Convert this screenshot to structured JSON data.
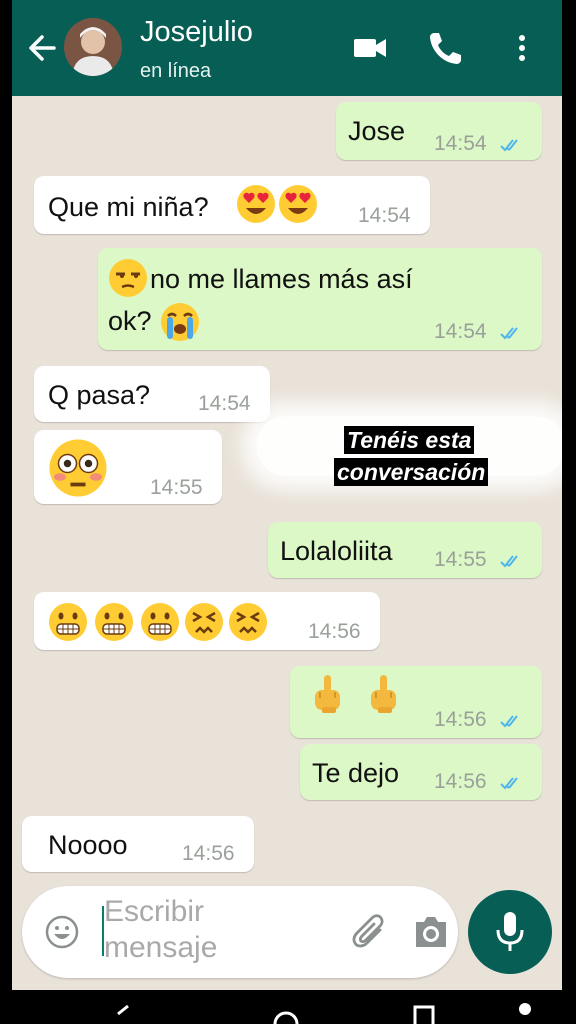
{
  "header": {
    "contact_name": "Josejulio",
    "status": "en línea",
    "icons": [
      "back-arrow-icon",
      "video-call-icon",
      "phone-icon",
      "more-vert-icon"
    ]
  },
  "messages": [
    {
      "direction": "out",
      "text": "Jose",
      "time": "14:54",
      "read": true
    },
    {
      "direction": "in",
      "text": "Que mi niña?",
      "emoji_after": [
        "heart-eyes",
        "heart-eyes"
      ],
      "time": "14:54"
    },
    {
      "direction": "out",
      "emoji_before": [
        "unamused"
      ],
      "text": "no me llames más así",
      "text2": "ok?",
      "emoji_end": [
        "loudly-crying"
      ],
      "time": "14:54",
      "read": true
    },
    {
      "direction": "in",
      "text": "Q pasa?",
      "time": "14:54"
    },
    {
      "direction": "in",
      "emoji": [
        "flushed"
      ],
      "time": "14:55"
    },
    {
      "direction": "out",
      "text": "Lolaloliita",
      "time": "14:55",
      "read": true
    },
    {
      "direction": "in",
      "emoji": [
        "grimacing",
        "grimacing",
        "grimacing",
        "confounded",
        "confounded"
      ],
      "time": "14:56"
    },
    {
      "direction": "out",
      "emoji": [
        "middle-finger",
        "middle-finger"
      ],
      "time": "14:56",
      "read": true
    },
    {
      "direction": "out",
      "text": "Te dejo",
      "time": "14:56",
      "read": true
    },
    {
      "direction": "in",
      "text": "Noooo",
      "time": "14:56"
    }
  ],
  "overlay_caption": {
    "line1": "Tenéis esta",
    "line2": "conversación"
  },
  "composer": {
    "placeholder_line1": "Escribir",
    "placeholder_line2": "mensaje",
    "icons": [
      "emoji-icon",
      "attach-icon",
      "camera-icon",
      "mic-icon"
    ]
  },
  "colors": {
    "header": "#075e54",
    "outgoing_bubble": "#dcf8c6",
    "incoming_bubble": "#ffffff",
    "read_ticks": "#4fb6ec",
    "chat_bg": "#e9e2d9"
  }
}
